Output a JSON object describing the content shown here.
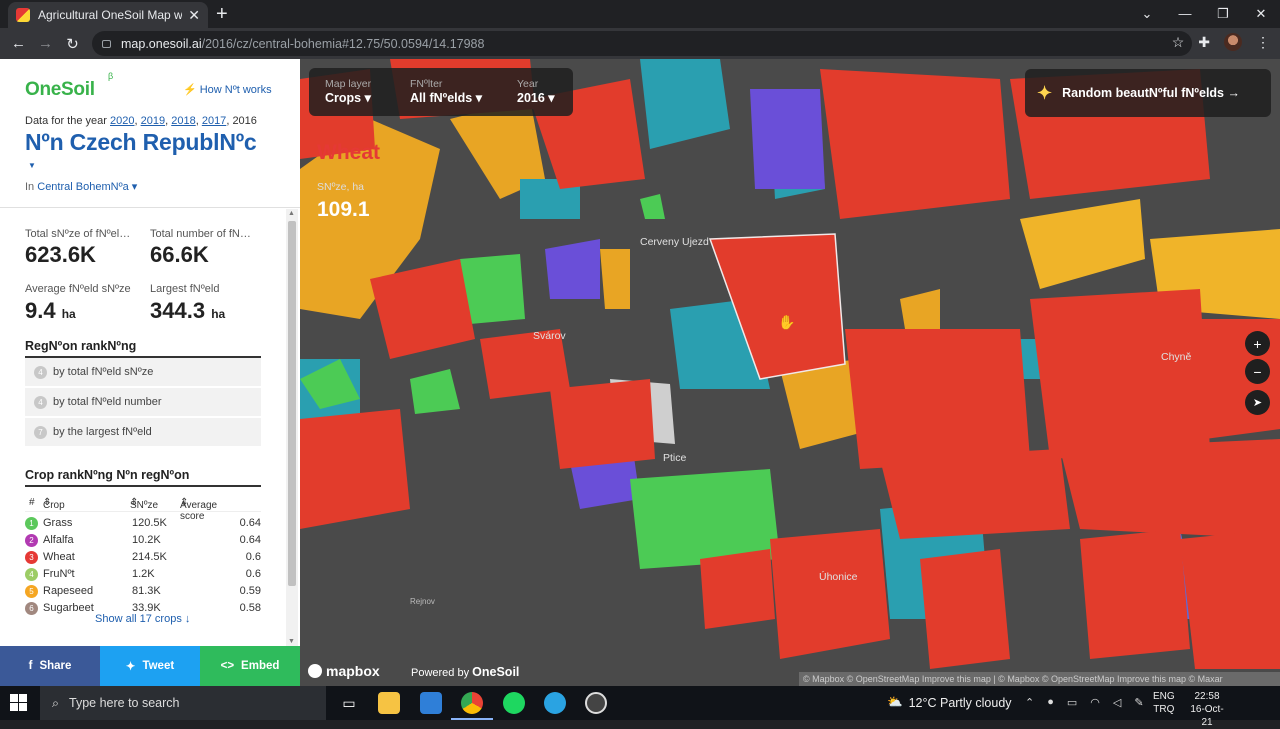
{
  "browser": {
    "tab_title": "Agricultural OneSoil Map with AI",
    "url_host": "map.onesoil.ai",
    "url_path": "/2016/cz/central-bohemia#12.75/50.0594/14.17988"
  },
  "panel": {
    "logo": "OneSoil",
    "logo_beta": "β",
    "how_it_works": "How Nºt works",
    "data_prefix": "Data for the year",
    "years_links": [
      "2020",
      "2019",
      "2018",
      "2017"
    ],
    "year_current": "2016",
    "country": "Nºn Czech RepublNºc",
    "region_prefix": "In",
    "region": "Central BohemNºa",
    "stats": {
      "total_size_label": "Total sNºze of fNºel…",
      "total_size_value": "623.6K",
      "total_number_label": "Total number of fN…",
      "total_number_value": "66.6K",
      "avg_size_label": "Average fNºeld sNºze",
      "avg_size_value": "9.4",
      "avg_size_unit": "ha",
      "largest_label": "Largest fNºeld",
      "largest_value": "344.3",
      "largest_unit": "ha"
    },
    "region_ranking": {
      "title": "RegNºon rankNºng",
      "rows": [
        {
          "rank": "4",
          "label": "by total fNºeld sNºze"
        },
        {
          "rank": "4",
          "label": "by total fNºeld number"
        },
        {
          "rank": "7",
          "label": "by the largest fNºeld"
        }
      ]
    },
    "crop_ranking": {
      "title": "Crop rankNºng Nºn regNºon",
      "col_num": "#",
      "col_crop": "Crop",
      "col_size": "SNºze",
      "col_score": "Average score",
      "rows": [
        {
          "n": "1",
          "crop": "Grass",
          "size": "120.5K",
          "score": "0.64",
          "color": "#5cc85c"
        },
        {
          "n": "2",
          "crop": "Alfalfa",
          "size": "10.2K",
          "score": "0.64",
          "color": "#b23ab2"
        },
        {
          "n": "3",
          "crop": "Wheat",
          "size": "214.5K",
          "score": "0.6",
          "color": "#e53935"
        },
        {
          "n": "4",
          "crop": "FruNºt",
          "size": "1.2K",
          "score": "0.6",
          "color": "#9ccc65"
        },
        {
          "n": "5",
          "crop": "Rapeseed",
          "size": "81.3K",
          "score": "0.59",
          "color": "#f5a623"
        },
        {
          "n": "6",
          "crop": "Sugarbeet",
          "size": "33.9K",
          "score": "0.58",
          "color": "#a1887f"
        }
      ],
      "show_all": "Show all 17 crops ↓"
    },
    "share": {
      "share": "Share",
      "tweet": "Tweet",
      "embed": "Embed"
    }
  },
  "map": {
    "controls": [
      {
        "label": "Map layer",
        "value": "Crops"
      },
      {
        "label": "FNºlter",
        "value": "All fNºelds"
      },
      {
        "label": "Year",
        "value": "2016"
      }
    ],
    "random_button": "Random beautNºful fNºelds →",
    "selected_crop": "Wheat",
    "size_label": "SNºze, ha",
    "size_value": "109.1",
    "places": [
      "Cerveny Ujezd",
      "Svárov",
      "Ptice",
      "Chyně",
      "Úhonice",
      "Rejnov"
    ],
    "mapbox": "mapbox",
    "powered_by": "Powered by",
    "powered_brand": "OneSoil",
    "attribution": "© Mapbox © OpenStreetMap Improve this map | © Mapbox © OpenStreetMap Improve this map © Maxar"
  },
  "taskbar": {
    "search_placeholder": "Type here to search",
    "weather": "12°C  Partly cloudy",
    "lang_1": "ENG",
    "lang_2": "TRQ",
    "time": "22:58",
    "date": "16-Oct-21"
  }
}
